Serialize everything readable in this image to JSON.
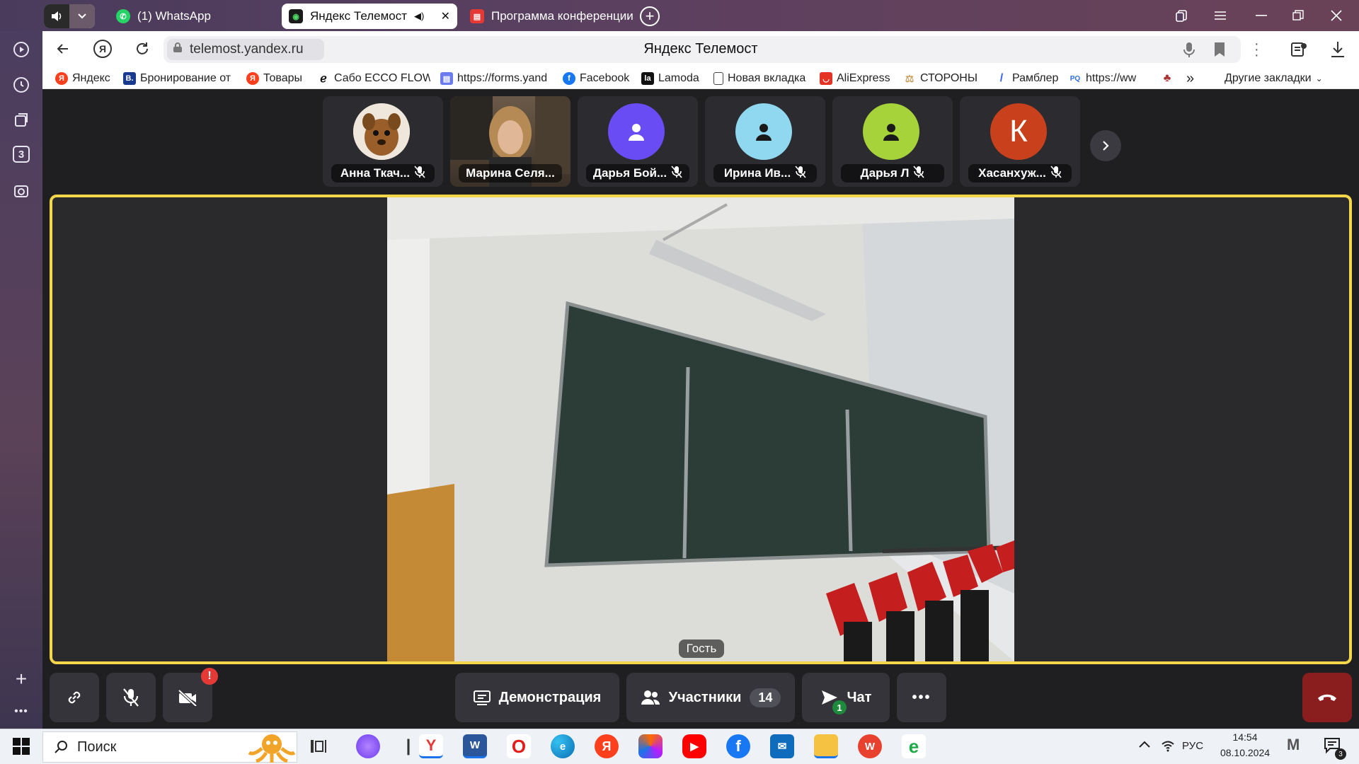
{
  "browser": {
    "tabs": [
      {
        "label": "(1) WhatsApp",
        "icon": "whatsapp-icon"
      },
      {
        "label": "Яндекс Телемост",
        "icon": "telemost-icon",
        "active": true
      },
      {
        "label": "Программа конференции",
        "icon": "pdf-icon"
      }
    ],
    "url": "telemost.yandex.ru",
    "page_title": "Яндекс Телемост",
    "bookmarks": [
      {
        "label": "Яндекс",
        "icon": "yandex-icon",
        "color": "#fc3f1d"
      },
      {
        "label": "Бронирование от",
        "icon": "booking-icon",
        "color": "#1a3a8f"
      },
      {
        "label": "Товары",
        "icon": "yandex-icon",
        "color": "#fc3f1d"
      },
      {
        "label": "Сабо ECCO FLOW",
        "icon": "ecco-icon",
        "color": "#111111"
      },
      {
        "label": "https://forms.yand",
        "icon": "forms-icon",
        "color": "#6a7cf0"
      },
      {
        "label": "Facebook",
        "icon": "facebook-icon",
        "color": "#1877f2"
      },
      {
        "label": "Lamoda",
        "icon": "lamoda-icon",
        "color": "#111111"
      },
      {
        "label": "Новая вкладка",
        "icon": "page-icon",
        "color": "#ffffff"
      },
      {
        "label": "AliExpress",
        "icon": "aliexpress-icon",
        "color": "#e43225"
      },
      {
        "label": "СТОРОНЫ",
        "icon": "scales-icon",
        "color": "#c8a060"
      },
      {
        "label": "Рамблер",
        "icon": "rambler-icon",
        "color": "#315efb"
      },
      {
        "label": "https://ww",
        "icon": "pq-icon",
        "color": "#2a6fdb"
      }
    ],
    "more_bookmarks": "»",
    "other_bookmarks": "Другие закладки"
  },
  "participants": [
    {
      "name": "Анна Ткач...",
      "avatar": "dog-photo",
      "color": "#8a5a2b"
    },
    {
      "name": "Марина Селя...",
      "avatar": "video-photo",
      "color": "#5a4a3a"
    },
    {
      "name": "Дарья Бой...",
      "avatar": "user-icon",
      "color": "#6a4cf5"
    },
    {
      "name": "Ирина Ив...",
      "avatar": "user-icon",
      "color": "#8fd8ef"
    },
    {
      "name": "Дарья Л",
      "avatar": "user-icon",
      "color": "#a6d23a"
    },
    {
      "name": "Хасанхуж...",
      "avatar": "letter",
      "letter": "К",
      "color": "#c8401c"
    }
  ],
  "main_video": {
    "label": "Гость"
  },
  "controls": {
    "demo_label": "Демонстрация",
    "participants_label": "Участники",
    "participants_count": "14",
    "chat_label": "Чат",
    "chat_badge": "1",
    "camera_alert": "!",
    "more": "•••"
  },
  "sidebar": {
    "counter": "3"
  },
  "taskbar": {
    "search_label": "Поиск",
    "language": "РУС",
    "time": "14:54",
    "date": "08.10.2024",
    "notif_badge": "3"
  },
  "colors": {
    "accent_border": "#f3d64a",
    "hangup": "#8a1e1e",
    "badge_green": "#1e8a3c"
  }
}
